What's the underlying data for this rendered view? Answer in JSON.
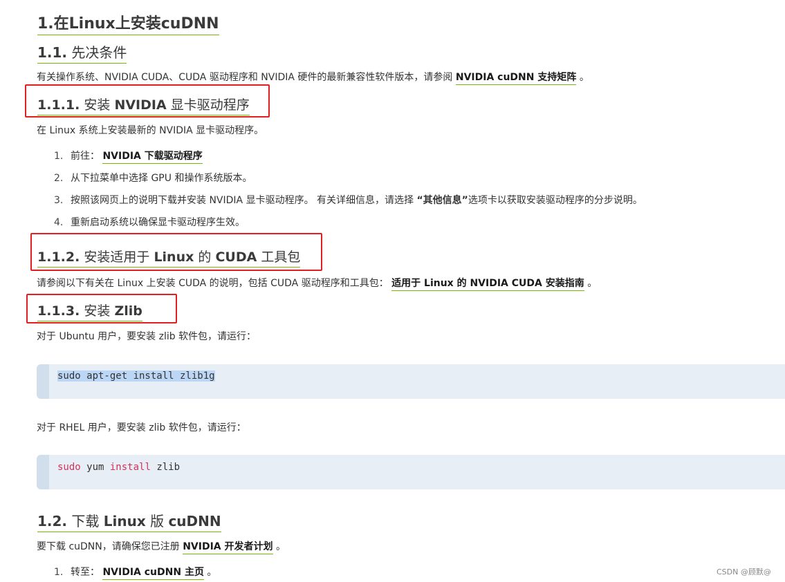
{
  "title": "1.在Linux上安装cuDNN",
  "s11": {
    "heading_num": "1.1.",
    "heading": "先决条件",
    "para_prefix": "有关操作系统、NVIDIA CUDA、CUDA 驱动程序和 NVIDIA 硬件的最新兼容性软件版本，请参阅",
    "para_link": "NVIDIA cuDNN 支持矩阵",
    "para_suffix": "。"
  },
  "s111": {
    "heading_num": "1.1.1.",
    "heading_pre": "安装",
    "heading_bold": "NVIDIA",
    "heading_post": "显卡驱动程序",
    "para": "在 Linux 系统上安装最新的 NVIDIA 显卡驱动程序。",
    "items": [
      {
        "num": "1.",
        "prefix": "前往：",
        "link": "NVIDIA 下载驱动程序"
      },
      {
        "num": "2.",
        "text": "从下拉菜单中选择 GPU 和操作系统版本。"
      },
      {
        "num": "3.",
        "text_pre": "按照该网页上的说明下载并安装 NVIDIA 显卡驱动程序。 有关详细信息，请选择",
        "bold": "“其他信息”",
        "text_post": "选项卡以获取安装驱动程序的分步说明。"
      },
      {
        "num": "4.",
        "text": "重新启动系统以确保显卡驱动程序生效。"
      }
    ]
  },
  "s112": {
    "heading_num": "1.1.2.",
    "heading_pre": "安装适用于",
    "heading_b1": "Linux",
    "heading_mid": "的",
    "heading_b2": "CUDA",
    "heading_post": "工具包",
    "para_prefix": "请参阅以下有关在 Linux 上安装 CUDA 的说明，包括 CUDA 驱动程序和工具包：",
    "para_link": "适用于 Linux 的 NVIDIA CUDA 安装指南",
    "para_suffix": "。"
  },
  "s113": {
    "heading_num": "1.1.3.",
    "heading_pre": "安装",
    "heading_bold": "Zlib",
    "para_ubuntu": "对于 Ubuntu 用户，要安装 zlib 软件包，请运行：",
    "code_ubuntu": "sudo apt-get install zlib1g",
    "para_rhel": "对于 RHEL 用户，要安装 zlib 软件包，请运行：",
    "code_rhel_kw1": "sudo",
    "code_rhel_w1": " yum ",
    "code_rhel_kw2": "install",
    "code_rhel_w2": " zlib"
  },
  "s12": {
    "heading_num": "1.2.",
    "heading_pre": "下载",
    "heading_b1": "Linux",
    "heading_mid": "版",
    "heading_b2": "cuDNN",
    "para_prefix": "要下载 cuDNN，请确保您已注册",
    "para_link": "NVIDIA 开发者计划",
    "para_suffix": "。",
    "items": [
      {
        "num": "1.",
        "prefix": "转至：",
        "link": "NVIDIA cuDNN 主页",
        "suffix": "。"
      }
    ]
  },
  "watermark": "CSDN @顾默@",
  "colors": {
    "accent_underline": "#76b900",
    "annotation_box": "#e02020",
    "code_bg": "#e8eef5",
    "code_keyword": "#d2335c"
  }
}
